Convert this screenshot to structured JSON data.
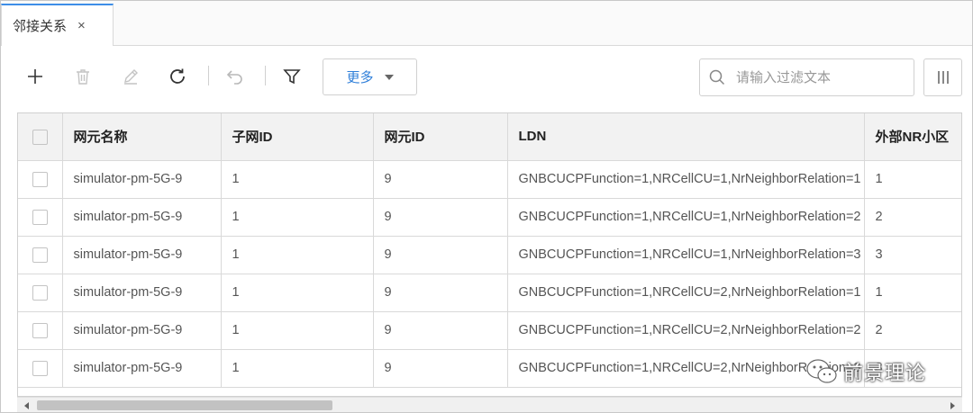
{
  "tab": {
    "title": "邻接关系",
    "close": "×"
  },
  "toolbar": {
    "more_label": "更多",
    "search_placeholder": "请输入过滤文本"
  },
  "table": {
    "columns": [
      "网元名称",
      "子网ID",
      "网元ID",
      "LDN",
      "外部NR小区"
    ],
    "rows": [
      [
        "simulator-pm-5G-9",
        "1",
        "9",
        "GNBCUCPFunction=1,NRCellCU=1,NrNeighborRelation=1",
        "1"
      ],
      [
        "simulator-pm-5G-9",
        "1",
        "9",
        "GNBCUCPFunction=1,NRCellCU=1,NrNeighborRelation=2",
        "2"
      ],
      [
        "simulator-pm-5G-9",
        "1",
        "9",
        "GNBCUCPFunction=1,NRCellCU=1,NrNeighborRelation=3",
        "3"
      ],
      [
        "simulator-pm-5G-9",
        "1",
        "9",
        "GNBCUCPFunction=1,NRCellCU=2,NrNeighborRelation=1",
        "1"
      ],
      [
        "simulator-pm-5G-9",
        "1",
        "9",
        "GNBCUCPFunction=1,NRCellCU=2,NrNeighborRelation=2",
        "2"
      ],
      [
        "simulator-pm-5G-9",
        "1",
        "9",
        "GNBCUCPFunction=1,NRCellCU=2,NrNeighborRelation=3",
        "3"
      ]
    ]
  },
  "watermark": {
    "text": "前景理论"
  },
  "icons": {
    "add": "plus-icon",
    "delete": "trash-icon",
    "edit": "pencil-icon",
    "refresh": "refresh-icon",
    "undo": "undo-icon",
    "filter": "filter-icon",
    "search": "search-icon",
    "columns": "columns-icon",
    "watermark": "wechat-icon"
  },
  "colors": {
    "accent": "#2f7fd9",
    "tab_indicator": "#3d8ee8",
    "header_bg": "#f2f2f2"
  }
}
